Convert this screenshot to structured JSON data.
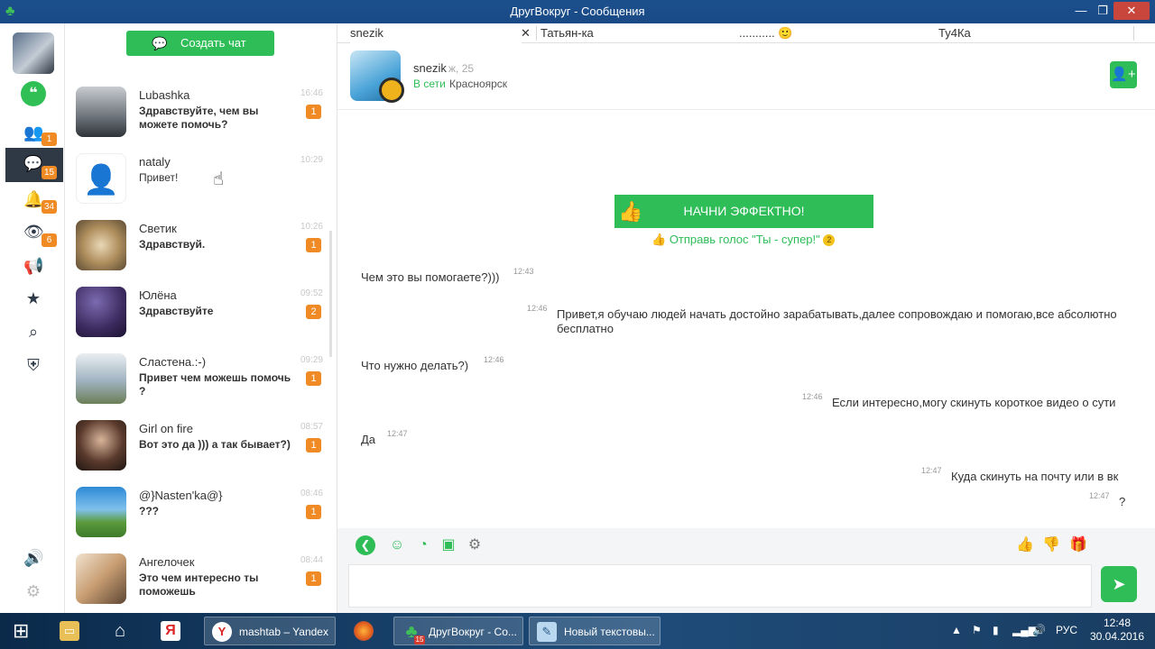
{
  "window": {
    "title": "ДругВокруг - Сообщения",
    "controls": {
      "minimize": "—",
      "maximize": "❐",
      "close": "✕"
    }
  },
  "rail": {
    "badges": {
      "friends": "1",
      "messages": "15",
      "notifications": "34",
      "guests": "6"
    }
  },
  "chat_list": {
    "create_chat_label": "Создать чат",
    "items": [
      {
        "name": "Lubashka",
        "message": "Здравствуйте, чем вы можете помочь?",
        "time": "16:46",
        "count": "1"
      },
      {
        "name": "nataly",
        "message": "Привет!",
        "time": "10:29",
        "count": ""
      },
      {
        "name": "Светик",
        "message": "Здравствуй.",
        "time": "10:26",
        "count": "1"
      },
      {
        "name": "Юлёна",
        "message": "Здравствуйте",
        "time": "09:52",
        "count": "2"
      },
      {
        "name": "Сластена.:-)",
        "message": "Привет чем можешь помочь ?",
        "time": "09:29",
        "count": "1"
      },
      {
        "name": "Girl on fire",
        "message": "Вот это да ))) а так бывает?)",
        "time": "08:57",
        "count": "1"
      },
      {
        "name": "@}Nasten'ka@}",
        "message": "???",
        "time": "08:46",
        "count": "1"
      },
      {
        "name": "Ангелочек",
        "message": "Это чем интересно ты поможешь",
        "time": "08:44",
        "count": "1"
      }
    ]
  },
  "tabs": [
    {
      "label": "snezik",
      "close": "✕"
    },
    {
      "label": "Татьян-ка"
    },
    {
      "label": "...........",
      "emoji": "🙂"
    },
    {
      "label": "Ту4Ка"
    }
  ],
  "conversation": {
    "name": "snezik",
    "age": "ж, 25",
    "status": "В сети",
    "city": "Красноярск",
    "promo_label": "НАЧНИ ЭФФЕКТНО!",
    "promo_sub": "Отправь голос \"Ты - супер!\"",
    "promo_cost": "2",
    "messages": [
      {
        "text": "Чем это вы помогаете?)))",
        "time": "12:43",
        "side": "in"
      },
      {
        "text": "Привет,я обучаю людей начать достойно зарабатывать,далее сопровождаю и помогаю,все абсолютно бесплатно",
        "time": "12:46",
        "side": "out"
      },
      {
        "text": "Что нужно делать?)",
        "time": "12:46",
        "side": "in"
      },
      {
        "text": "Если интересно,могу скинуть короткое видео о сути",
        "time": "12:46",
        "side": "out"
      },
      {
        "text": "Да",
        "time": "12:47",
        "side": "in"
      },
      {
        "text": "Куда скинуть на почту или в вк",
        "time": "12:47",
        "side": "out"
      },
      {
        "text": "?",
        "time": "12:47",
        "side": "out"
      }
    ]
  },
  "taskbar": {
    "items": [
      {
        "label": "mashtab – Yandex",
        "icon": "Y"
      },
      {
        "label": "ДругВокруг - Со...",
        "icon": "♣",
        "badge": "15"
      },
      {
        "label": "Новый текстовы...",
        "icon": "✎"
      }
    ],
    "lang": "РУС",
    "time": "12:48",
    "date": "30.04.2016"
  },
  "colors": {
    "accent": "#2ebd57",
    "badge": "#f08a24",
    "titlebar": "#1b4f8c"
  }
}
